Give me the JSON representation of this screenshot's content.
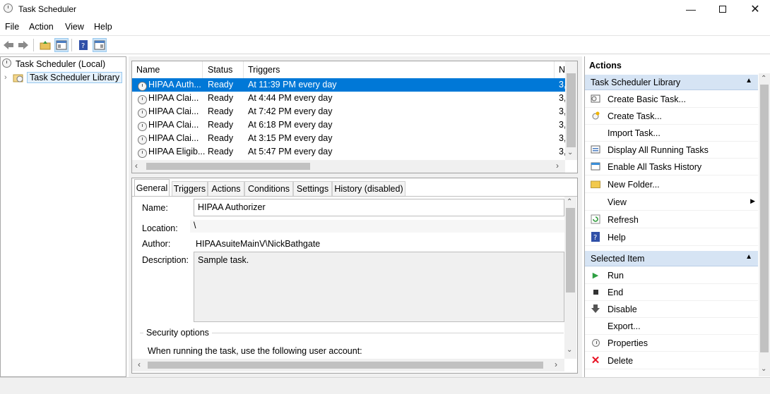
{
  "window": {
    "title": "Task Scheduler"
  },
  "menu": [
    "File",
    "Action",
    "View",
    "Help"
  ],
  "tree": {
    "root": "Task Scheduler (Local)",
    "library": "Task Scheduler Library"
  },
  "tasklist": {
    "columns": [
      "Name",
      "Status",
      "Triggers",
      "N"
    ],
    "rows": [
      {
        "name": "HIPAA Auth...",
        "status": "Ready",
        "trigger": "At 11:39 PM every day",
        "next": "3,",
        "selected": true
      },
      {
        "name": "HIPAA Clai...",
        "status": "Ready",
        "trigger": "At 4:44 PM every day",
        "next": "3,"
      },
      {
        "name": "HIPAA Clai...",
        "status": "Ready",
        "trigger": "At 7:42 PM every day",
        "next": "3,"
      },
      {
        "name": "HIPAA Clai...",
        "status": "Ready",
        "trigger": "At 6:18 PM every day",
        "next": "3,"
      },
      {
        "name": "HIPAA Clai...",
        "status": "Ready",
        "trigger": "At 3:15 PM every day",
        "next": "3,"
      },
      {
        "name": "HIPAA Eligib...",
        "status": "Ready",
        "trigger": "At 5:47 PM every day",
        "next": "3,"
      }
    ]
  },
  "details": {
    "tabs": [
      "General",
      "Triggers",
      "Actions",
      "Conditions",
      "Settings",
      "History (disabled)"
    ],
    "name_label": "Name:",
    "name_value": "HIPAA Authorizer",
    "location_label": "Location:",
    "location_value": "\\",
    "author_label": "Author:",
    "author_value": "HIPAAsuiteMainV\\NickBathgate",
    "description_label": "Description:",
    "description_value": "Sample task.",
    "security_legend": "Security options",
    "security_text": "When running the task, use the following user account:"
  },
  "actions": {
    "title": "Actions",
    "library_section": "Task Scheduler Library",
    "library_items": [
      {
        "label": "Create Basic Task...",
        "icon": "create-basic-task-icon"
      },
      {
        "label": "Create Task...",
        "icon": "create-task-icon"
      },
      {
        "label": "Import Task...",
        "icon": ""
      },
      {
        "label": "Display All Running Tasks",
        "icon": "running-tasks-icon"
      },
      {
        "label": "Enable All Tasks History",
        "icon": "tasks-history-icon"
      },
      {
        "label": "New Folder...",
        "icon": "folder-icon"
      },
      {
        "label": "View",
        "icon": ""
      },
      {
        "label": "Refresh",
        "icon": "refresh-icon"
      },
      {
        "label": "Help",
        "icon": "help-icon"
      }
    ],
    "selected_section": "Selected Item",
    "selected_items": [
      {
        "label": "Run",
        "icon": "run-icon"
      },
      {
        "label": "End",
        "icon": "end-icon"
      },
      {
        "label": "Disable",
        "icon": "disable-icon"
      },
      {
        "label": "Export...",
        "icon": ""
      },
      {
        "label": "Properties",
        "icon": "properties-icon"
      },
      {
        "label": "Delete",
        "icon": "delete-icon"
      }
    ]
  },
  "colors": {
    "selection": "#0078d7",
    "section_header": "#d6e4f4",
    "run": "#2ea043",
    "delete": "#e81123"
  }
}
